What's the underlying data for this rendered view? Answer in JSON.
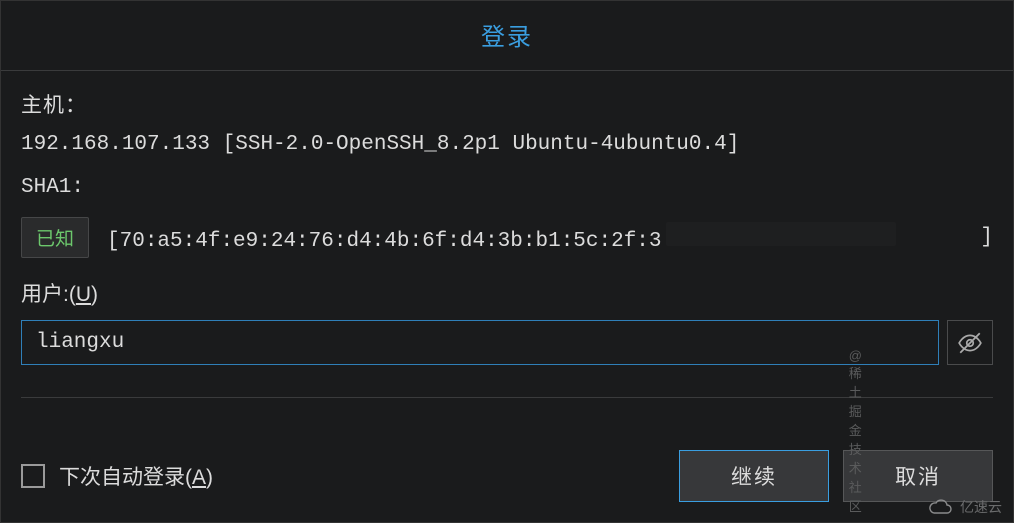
{
  "title": "登录",
  "host": {
    "label": "主机：",
    "value": "192.168.107.133 [SSH-2.0-OpenSSH_8.2p1 Ubuntu-4ubuntu0.4]"
  },
  "sha1": {
    "label": "SHA1:",
    "known_badge": "已知",
    "fingerprint_visible": "70:a5:4f:e9:24:76:d4:4b:6f:d4:3b:b1:5c:2f:3",
    "bracket_open": "[",
    "bracket_close": "]"
  },
  "user": {
    "label_prefix": "用户:(",
    "label_key": "U",
    "label_suffix": ")",
    "value": "liangxu"
  },
  "auto_login": {
    "label_prefix": "下次自动登录(",
    "label_key": "A",
    "label_suffix": ")",
    "checked": false
  },
  "buttons": {
    "continue": "继续",
    "cancel": "取消"
  },
  "watermark": {
    "juejin": "@稀土掘金技术社区",
    "brand": "亿速云"
  }
}
